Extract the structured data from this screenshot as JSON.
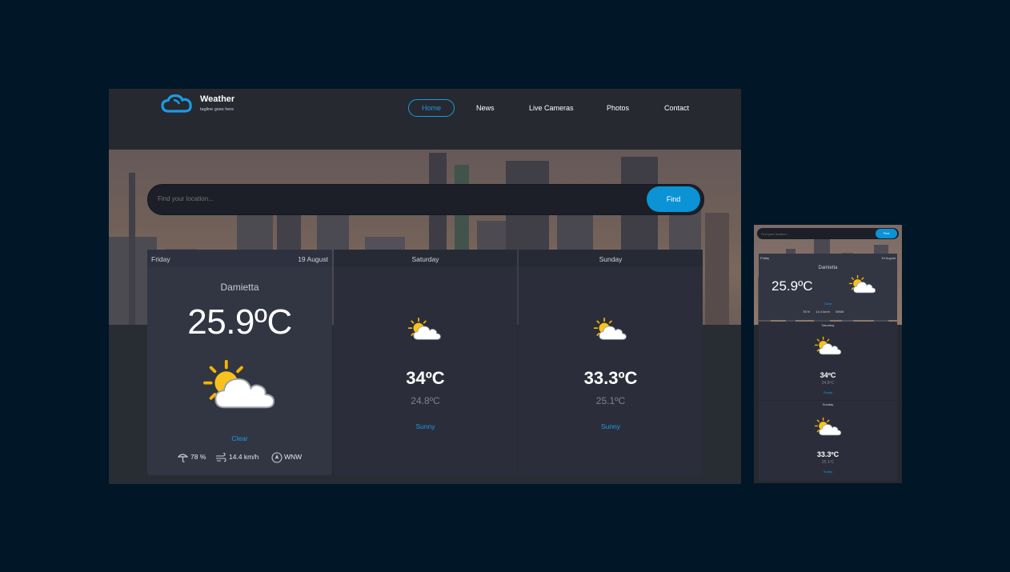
{
  "brand": {
    "title": "Weather",
    "tagline": "tagline goes here"
  },
  "nav": {
    "items": [
      "Home",
      "News",
      "Live Cameras",
      "Photos",
      "Contact"
    ],
    "active": "Home"
  },
  "search": {
    "placeholder": "Find your location...",
    "button": "Find"
  },
  "colors": {
    "accent": "#1b9ce3",
    "page_bg": "#011627",
    "card_bg": "#323643"
  },
  "today": {
    "day": "Friday",
    "date": "19 August",
    "city": "Damietta",
    "temp": "25.9ºC",
    "icon": "partly-sunny-icon",
    "condition": "Clear",
    "humidity": "78 %",
    "wind": "14.4 km/h",
    "direction": "WNW"
  },
  "forecast": [
    {
      "day": "Saturday",
      "icon": "partly-sunny-icon",
      "max": "34ºC",
      "min": "24.8ºC",
      "condition": "Sunny"
    },
    {
      "day": "Sunday",
      "icon": "partly-sunny-icon",
      "max": "33.3ºC",
      "min": "25.1ºC",
      "condition": "Sunny"
    }
  ]
}
